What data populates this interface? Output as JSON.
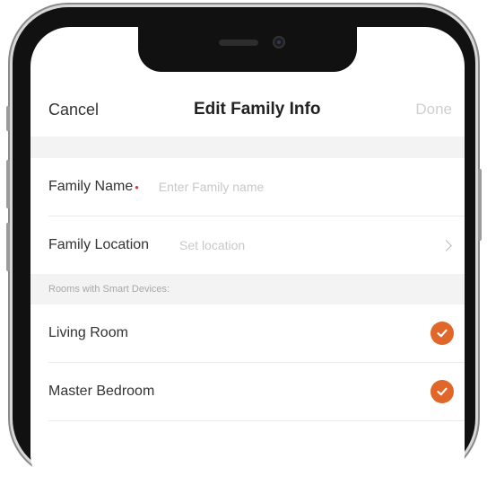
{
  "nav": {
    "cancel_label": "Cancel",
    "title": "Edit Family Info",
    "done_label": "Done"
  },
  "form": {
    "family_name_label": "Family Name",
    "family_name_required_mark": "•",
    "family_name_placeholder": "Enter Family name",
    "family_location_label": "Family Location",
    "family_location_placeholder": "Set location"
  },
  "rooms": {
    "section_header": "Rooms with Smart Devices:",
    "items": [
      {
        "label": "Living Room",
        "checked": true
      },
      {
        "label": "Master Bedroom",
        "checked": true
      }
    ]
  },
  "colors": {
    "accent": "#e0662a",
    "required": "#e23a3a"
  }
}
